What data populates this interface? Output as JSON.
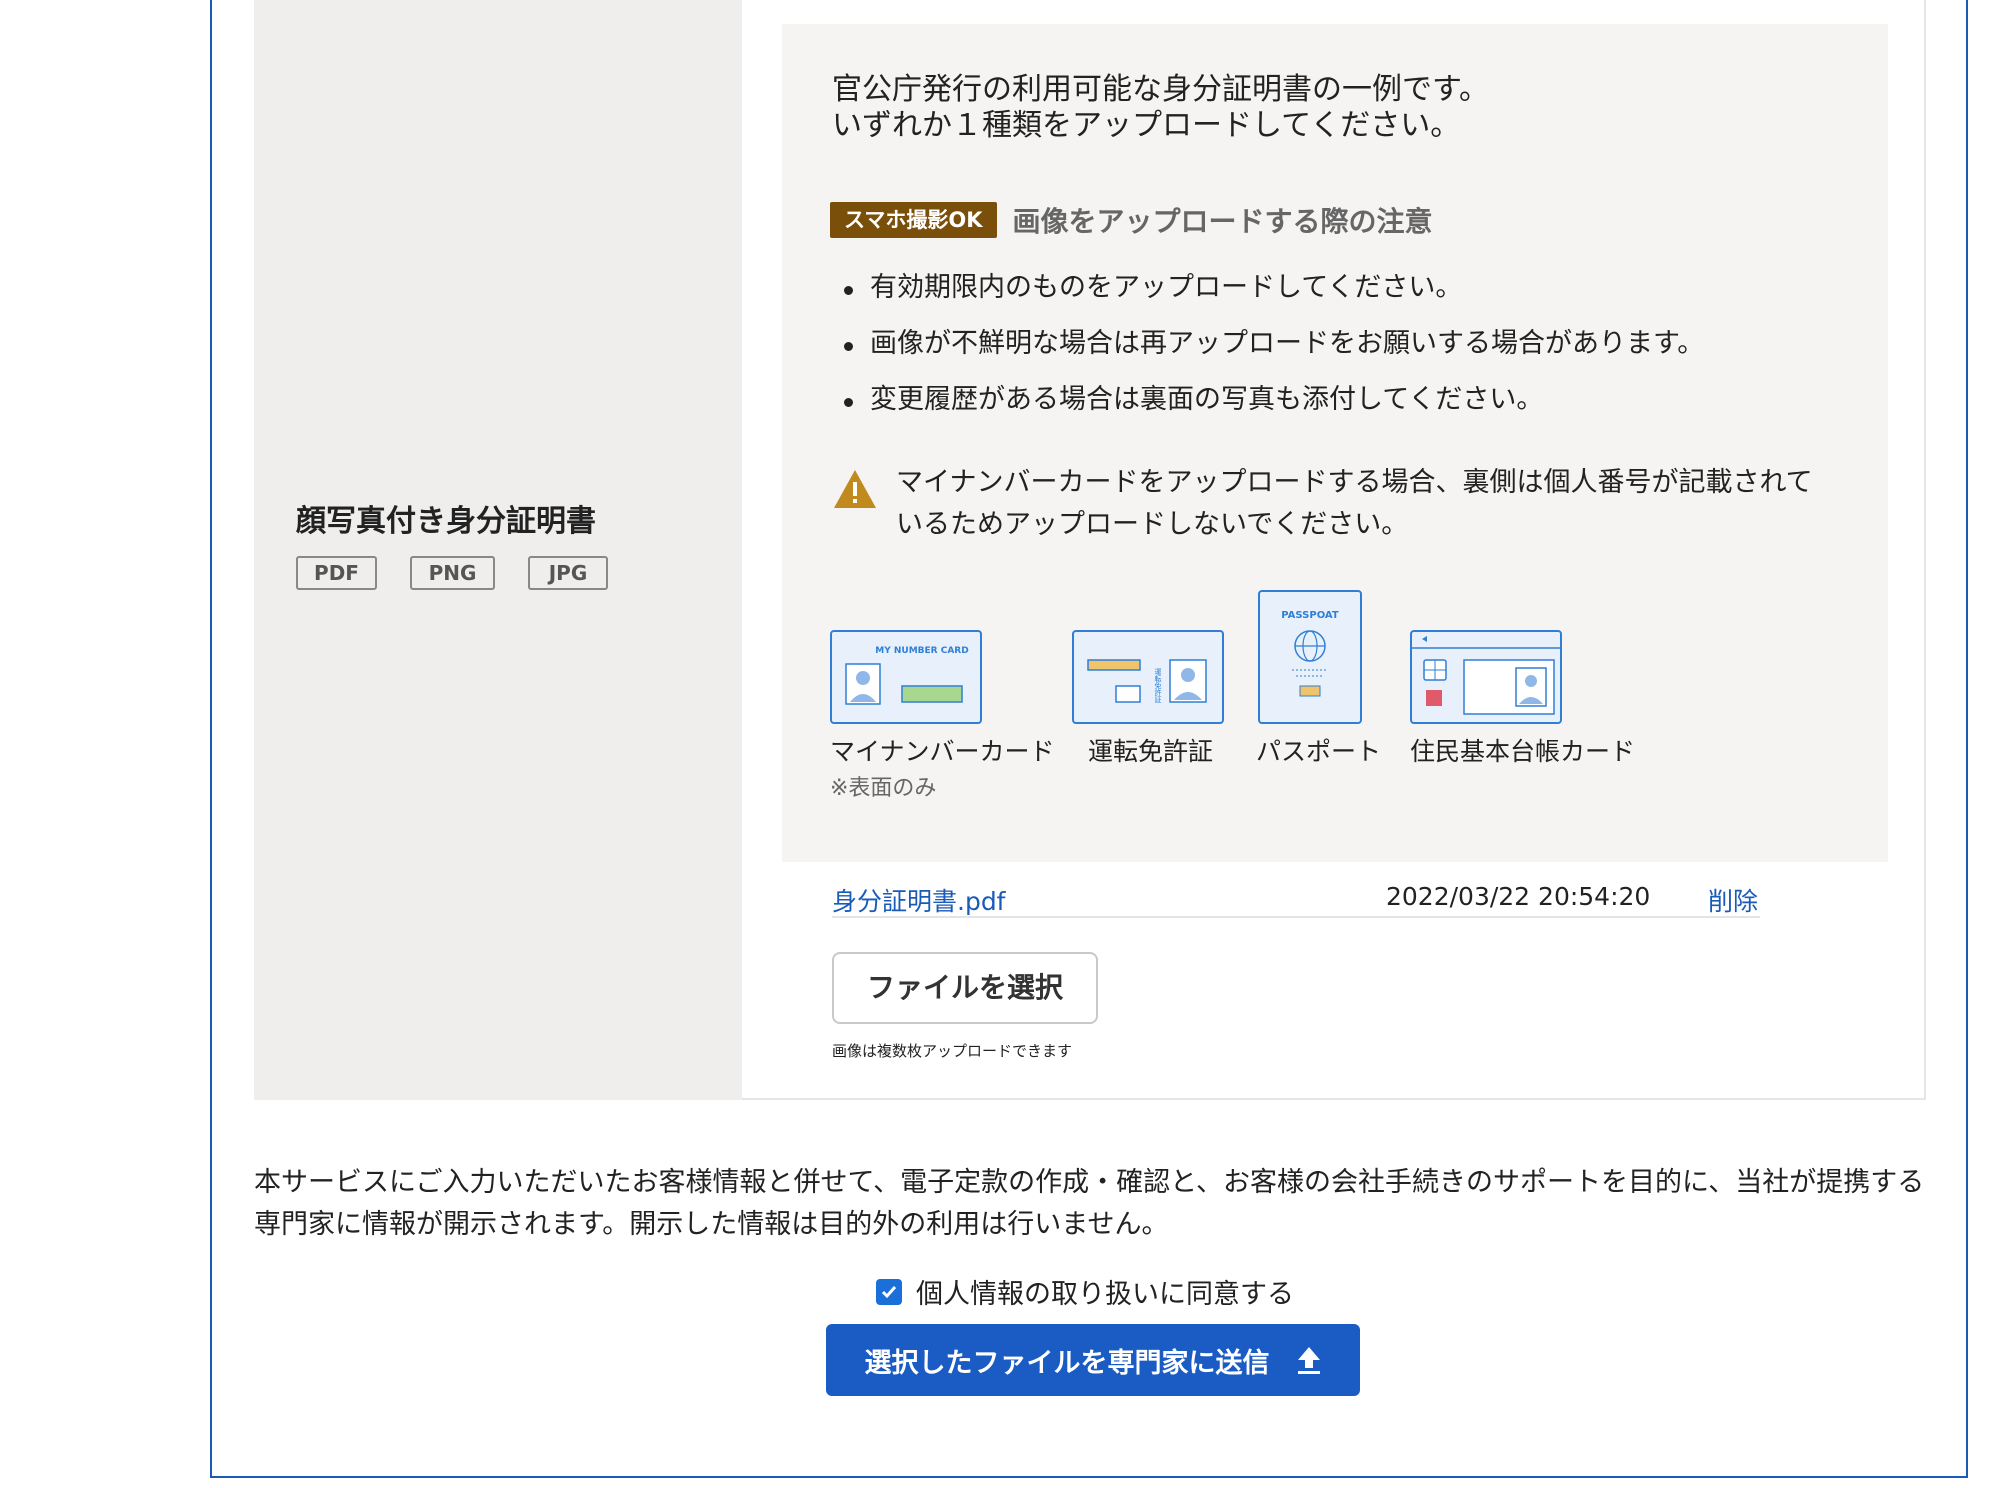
{
  "section": {
    "title": "顔写真付き身分証明書",
    "formats": [
      "PDF",
      "PNG",
      "JPG"
    ]
  },
  "info": {
    "intro_line1": "官公庁発行の利用可能な身分証明書の一例です。",
    "intro_line2": "いずれか１種類をアップロードしてください。",
    "ok_badge": "スマホ撮影OK",
    "notice_title": "画像をアップロードする際の注意",
    "bullets": [
      "有効期限内のものをアップロードしてください。",
      "画像が不鮮明な場合は再アップロードをお願いする場合があります。",
      "変更履歴がある場合は裏面の写真も添付してください。"
    ],
    "warning": "マイナンバーカードをアップロードする場合、裏側は個人番号が記載されているためアップロードしないでください。",
    "cards": {
      "mynumber_label": "マイナンバーカード",
      "mynumber_note": "※表面のみ",
      "mynumber_card_text": "MY NUMBER CARD",
      "license_label": "運転免許証",
      "license_card_text": "運転免許証",
      "passport_label": "パスポート",
      "passport_card_text": "PASSPOAT",
      "residence_label": "住民基本台帳カード"
    }
  },
  "file": {
    "name": "身分証明書.pdf",
    "date": "2022/03/22 20:54:20",
    "delete_label": "削除"
  },
  "choose_button": "ファイルを選択",
  "multi_note": "画像は複数枚アップロードできます",
  "consent_text": "本サービスにご入力いただいたお客様情報と併せて、電子定款の作成・確認と、お客様の会社手続きのサポートを目的に、当社が提携する専門家に情報が開示されます。開示した情報は目的外の利用は行いません。",
  "agree_label": "個人情報の取り扱いに同意する",
  "agree_checked": true,
  "submit_label": "選択したファイルを専門家に送信",
  "colors": {
    "primary": "#1a5bc4",
    "link": "#1a5bb8",
    "ok_badge_bg": "#7a4f0a",
    "warning": "#c08a1e",
    "card_accent": "#2f7fd6"
  }
}
